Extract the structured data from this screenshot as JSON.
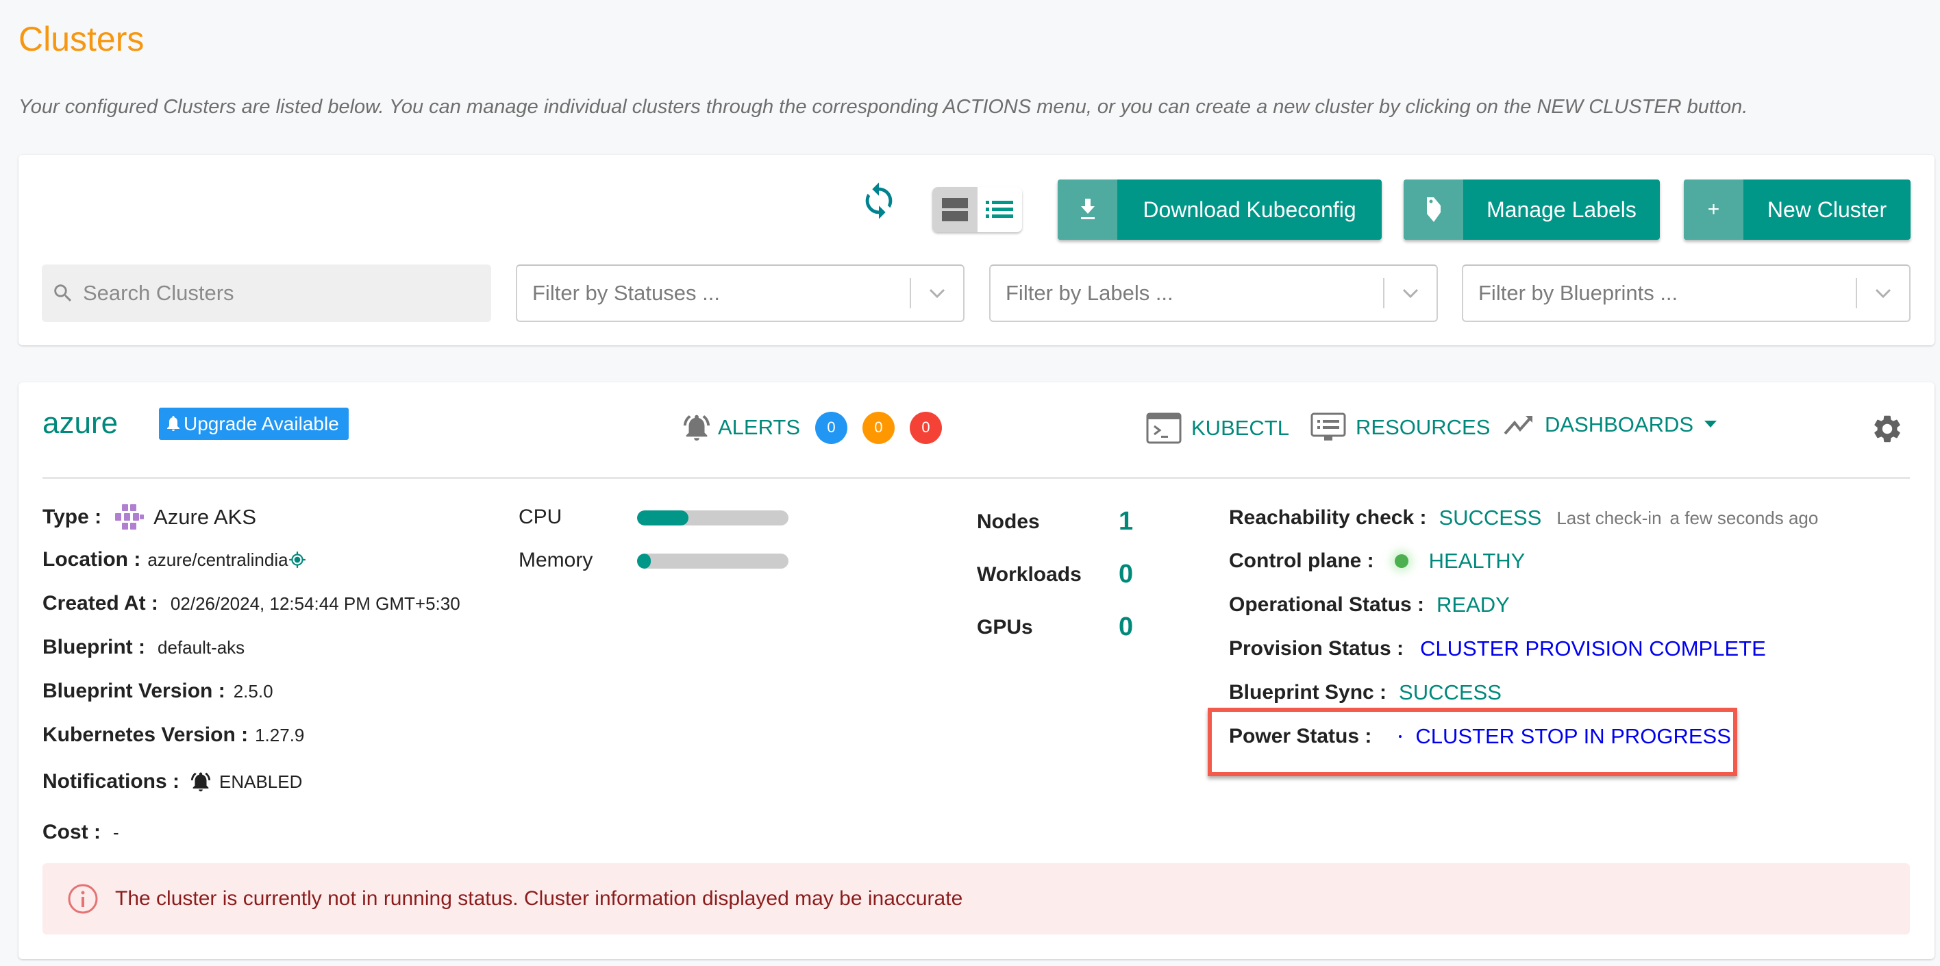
{
  "header": {
    "title": "Clusters",
    "subtitle": "Your configured Clusters are listed below. You can manage individual clusters through the corresponding ACTIONS menu, or you can create a new cluster by clicking on the NEW CLUSTER button."
  },
  "toolbar": {
    "refresh_icon": "refresh-icon",
    "view_modes": [
      "card",
      "list"
    ],
    "active_view": "card",
    "download_kubeconfig_label": "Download Kubeconfig",
    "manage_labels_label": "Manage Labels",
    "new_cluster_label": "New Cluster",
    "new_cluster_icon_glyph": "+",
    "search_placeholder": "Search Clusters",
    "filters": {
      "statuses_placeholder": "Filter by Statuses ...",
      "labels_placeholder": "Filter by Labels ...",
      "blueprints_placeholder": "Filter by Blueprints ..."
    }
  },
  "cluster": {
    "name": "azure",
    "upgrade_badge": "Upgrade Available",
    "alerts": {
      "label": "ALERTS",
      "counts": [
        "0",
        "0",
        "0"
      ]
    },
    "actions": {
      "kubectl": "KUBECTL",
      "resources": "RESOURCES",
      "dashboards": "DASHBOARDS"
    },
    "details": {
      "type_label": "Type :",
      "type_value": "Azure AKS",
      "location_label": "Location :",
      "location_value": "azure/centralindia",
      "created_label": "Created At :",
      "created_value": "02/26/2024, 12:54:44 PM GMT+5:30",
      "blueprint_label": "Blueprint :",
      "blueprint_value": "default-aks",
      "blueprint_version_label": "Blueprint Version :",
      "blueprint_version_value": "2.5.0",
      "k8s_version_label": "Kubernetes Version :",
      "k8s_version_value": "1.27.9",
      "notifications_label": "Notifications :",
      "notifications_value": "ENABLED",
      "cost_label": "Cost :",
      "cost_value": "-"
    },
    "usage": {
      "cpu_label": "CPU",
      "cpu_fraction": 0.34,
      "memory_label": "Memory",
      "memory_fraction": 0.08
    },
    "counts": {
      "nodes_label": "Nodes",
      "nodes_value": "1",
      "workloads_label": "Workloads",
      "workloads_value": "0",
      "gpus_label": "GPUs",
      "gpus_value": "0"
    },
    "status": {
      "reachability_label": "Reachability check :",
      "reachability_value": "SUCCESS",
      "last_checkin_label": "Last check-in",
      "last_checkin_value": "a few seconds ago",
      "control_plane_label": "Control plane :",
      "control_plane_value": "HEALTHY",
      "operational_label": "Operational Status :",
      "operational_value": "READY",
      "provision_label": "Provision Status :",
      "provision_value": "CLUSTER PROVISION COMPLETE",
      "blueprint_sync_label": "Blueprint Sync :",
      "blueprint_sync_value": "SUCCESS",
      "power_label": "Power Status :",
      "power_value": "CLUSTER STOP IN PROGRESS"
    },
    "warning_banner": "The cluster is currently not in running status. Cluster information displayed may be inaccurate"
  },
  "colors": {
    "title_orange": "#f7960f",
    "primary_teal": "#009688",
    "link_blue": "#0000ee",
    "badge_blue": "#2196f3",
    "badge_orange": "#ff9800",
    "badge_red": "#f44336",
    "healthy_green": "#4caf50",
    "highlight_red": "#f25b4c",
    "banner_bg": "#fcecec",
    "banner_text": "#8c1c1c"
  }
}
